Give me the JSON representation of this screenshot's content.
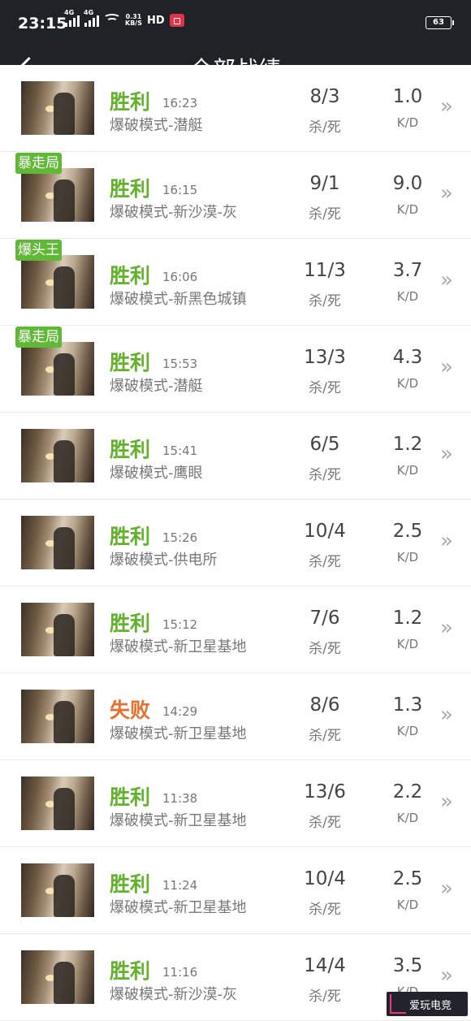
{
  "status_bar": {
    "time": "23:15",
    "net1": "4G",
    "net2": "4G",
    "speed_top": "0.31",
    "speed_bottom": "KB/S",
    "hd": "HD",
    "battery": "63"
  },
  "header": {
    "title": "全部战绩"
  },
  "labels": {
    "kd_label": "杀/死",
    "ratio_label": "K/D"
  },
  "matches": [
    {
      "result": "胜利",
      "outcome": "win",
      "time": "16:23",
      "mode": "爆破模式-潜艇",
      "kd": "8/3",
      "ratio": "1.0",
      "badge": ""
    },
    {
      "result": "胜利",
      "outcome": "win",
      "time": "16:15",
      "mode": "爆破模式-新沙漠-灰",
      "kd": "9/1",
      "ratio": "9.0",
      "badge": "暴走局"
    },
    {
      "result": "胜利",
      "outcome": "win",
      "time": "16:06",
      "mode": "爆破模式-新黑色城镇",
      "kd": "11/3",
      "ratio": "3.7",
      "badge": "爆头王"
    },
    {
      "result": "胜利",
      "outcome": "win",
      "time": "15:53",
      "mode": "爆破模式-潜艇",
      "kd": "13/3",
      "ratio": "4.3",
      "badge": "暴走局"
    },
    {
      "result": "胜利",
      "outcome": "win",
      "time": "15:41",
      "mode": "爆破模式-鹰眼",
      "kd": "6/5",
      "ratio": "1.2",
      "badge": ""
    },
    {
      "result": "胜利",
      "outcome": "win",
      "time": "15:26",
      "mode": "爆破模式-供电所",
      "kd": "10/4",
      "ratio": "2.5",
      "badge": ""
    },
    {
      "result": "胜利",
      "outcome": "win",
      "time": "15:12",
      "mode": "爆破模式-新卫星基地",
      "kd": "7/6",
      "ratio": "1.2",
      "badge": ""
    },
    {
      "result": "失败",
      "outcome": "loss",
      "time": "14:29",
      "mode": "爆破模式-新卫星基地",
      "kd": "8/6",
      "ratio": "1.3",
      "badge": ""
    },
    {
      "result": "胜利",
      "outcome": "win",
      "time": "11:38",
      "mode": "爆破模式-新卫星基地",
      "kd": "13/6",
      "ratio": "2.2",
      "badge": ""
    },
    {
      "result": "胜利",
      "outcome": "win",
      "time": "11:24",
      "mode": "爆破模式-新卫星基地",
      "kd": "10/4",
      "ratio": "2.5",
      "badge": ""
    },
    {
      "result": "胜利",
      "outcome": "win",
      "time": "11:16",
      "mode": "爆破模式-新沙漠-灰",
      "kd": "14/4",
      "ratio": "3.5",
      "badge": ""
    }
  ],
  "watermark": {
    "text": "爱玩电竞"
  }
}
